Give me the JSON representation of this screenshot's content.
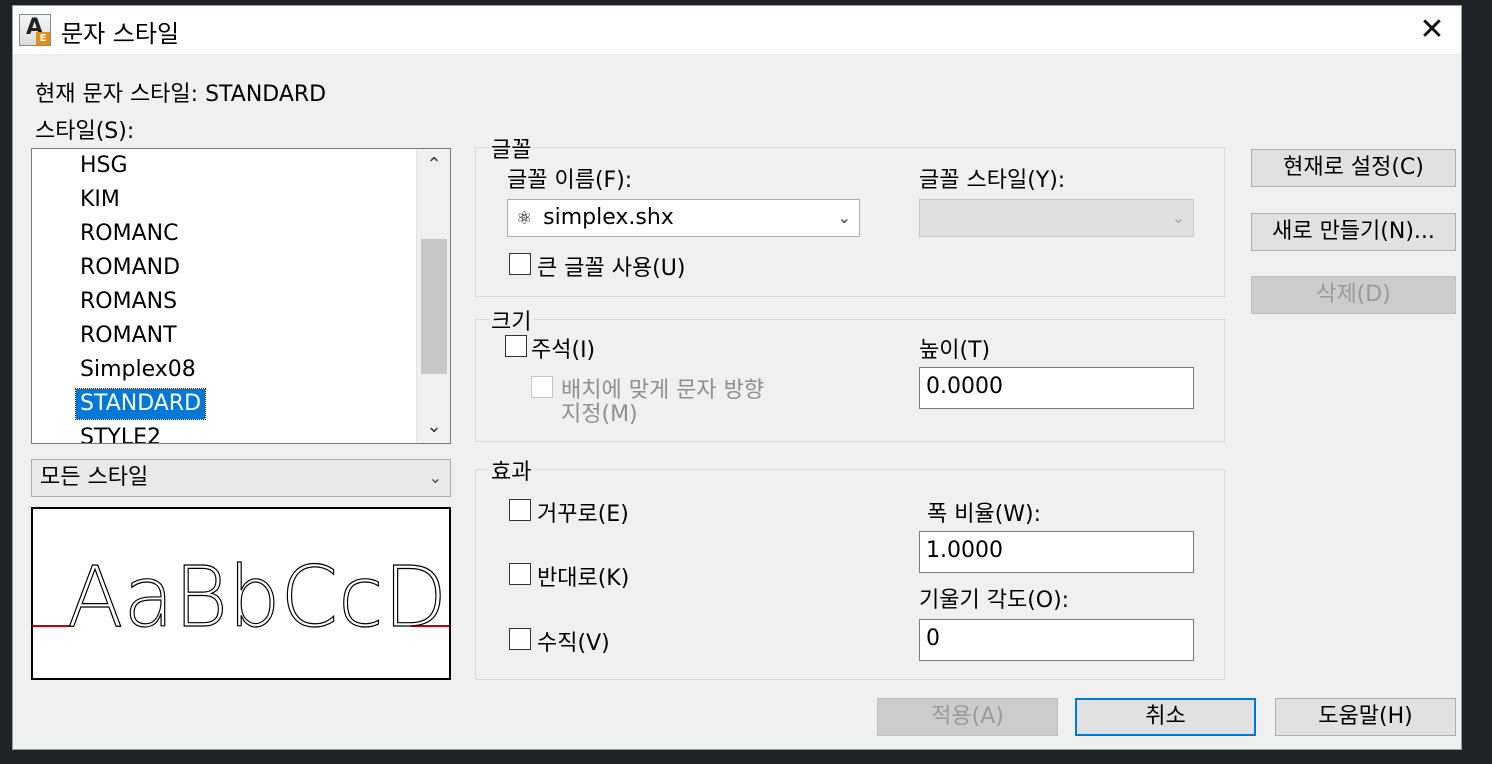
{
  "window": {
    "title": "문자 스타일",
    "close_glyph": "✕"
  },
  "current_style_label": "현재 문자 스타일: STANDARD",
  "styles_label": "스타일(S):",
  "styles": [
    {
      "name": "HSG"
    },
    {
      "name": "KIM"
    },
    {
      "name": "ROMANC"
    },
    {
      "name": "ROMAND"
    },
    {
      "name": "ROMANS"
    },
    {
      "name": "ROMANT"
    },
    {
      "name": "Simplex08"
    },
    {
      "name": "STANDARD",
      "selected": true
    },
    {
      "name": "STYLE2"
    }
  ],
  "filter": {
    "value": "모든 스타일"
  },
  "preview": {
    "text": "AaBbCcD"
  },
  "font_group": {
    "title": "글꼴",
    "font_name_label": "글꼴 이름(F):",
    "font_name_value": "simplex.shx",
    "font_style_label": "글꼴 스타일(Y):",
    "bigfont_label": "큰 글꼴 사용(U)"
  },
  "size_group": {
    "title": "크기",
    "annotative_label": "주석(I)",
    "match_orientation_label_1": "배치에 맞게 문자 방향",
    "match_orientation_label_2": "지정(M)",
    "height_label": "높이(T)",
    "height_value": "0.0000"
  },
  "effects_group": {
    "title": "효과",
    "upside_down_label": "거꾸로(E)",
    "backwards_label": "반대로(K)",
    "vertical_label": "수직(V)",
    "width_factor_label": "폭 비율(W):",
    "width_factor_value": "1.0000",
    "oblique_label": "기울기 각도(O):",
    "oblique_value": "0"
  },
  "buttons": {
    "set_current": "현재로 설정(C)",
    "new": "새로 만들기(N)...",
    "delete": "삭제(D)",
    "apply": "적용(A)",
    "cancel": "취소",
    "help": "도움말(H)"
  },
  "colors": {
    "accent": "#0078d7",
    "baseline": "#c00000"
  }
}
